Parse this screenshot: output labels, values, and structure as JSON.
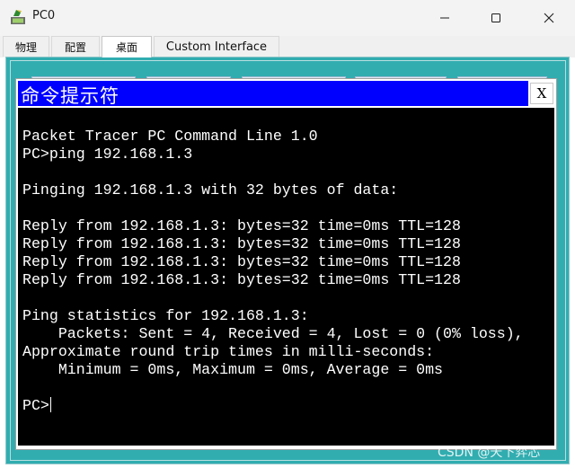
{
  "window": {
    "title": "PC0",
    "icon": "packet-tracer-pc-icon",
    "controls": [
      "minimize-icon",
      "maximize-icon",
      "close-icon"
    ]
  },
  "tabs": [
    {
      "label": "物理"
    },
    {
      "label": "配置"
    },
    {
      "label": "桌面",
      "selected": true
    },
    {
      "label": "Custom Interface"
    }
  ],
  "cmd_window": {
    "title": "命令提示符",
    "close_label": "X",
    "lines": [
      "Packet Tracer PC Command Line 1.0",
      "PC>ping 192.168.1.3",
      "",
      "Pinging 192.168.1.3 with 32 bytes of data:",
      "",
      "Reply from 192.168.1.3: bytes=32 time=0ms TTL=128",
      "Reply from 192.168.1.3: bytes=32 time=0ms TTL=128",
      "Reply from 192.168.1.3: bytes=32 time=0ms TTL=128",
      "Reply from 192.168.1.3: bytes=32 time=0ms TTL=128",
      "",
      "Ping statistics for 192.168.1.3:",
      "    Packets: Sent = 4, Received = 4, Lost = 0 (0% loss),",
      "Approximate round trip times in milli-seconds:",
      "    Minimum = 0ms, Maximum = 0ms, Average = 0ms",
      ""
    ],
    "prompt": "PC>"
  },
  "watermark": "CSDN @天下弈芯",
  "colors": {
    "desktop_bg": "#31adb0",
    "cmd_titlebar": "#0000ff",
    "terminal_bg": "#000000",
    "terminal_text": "#ffffff"
  }
}
